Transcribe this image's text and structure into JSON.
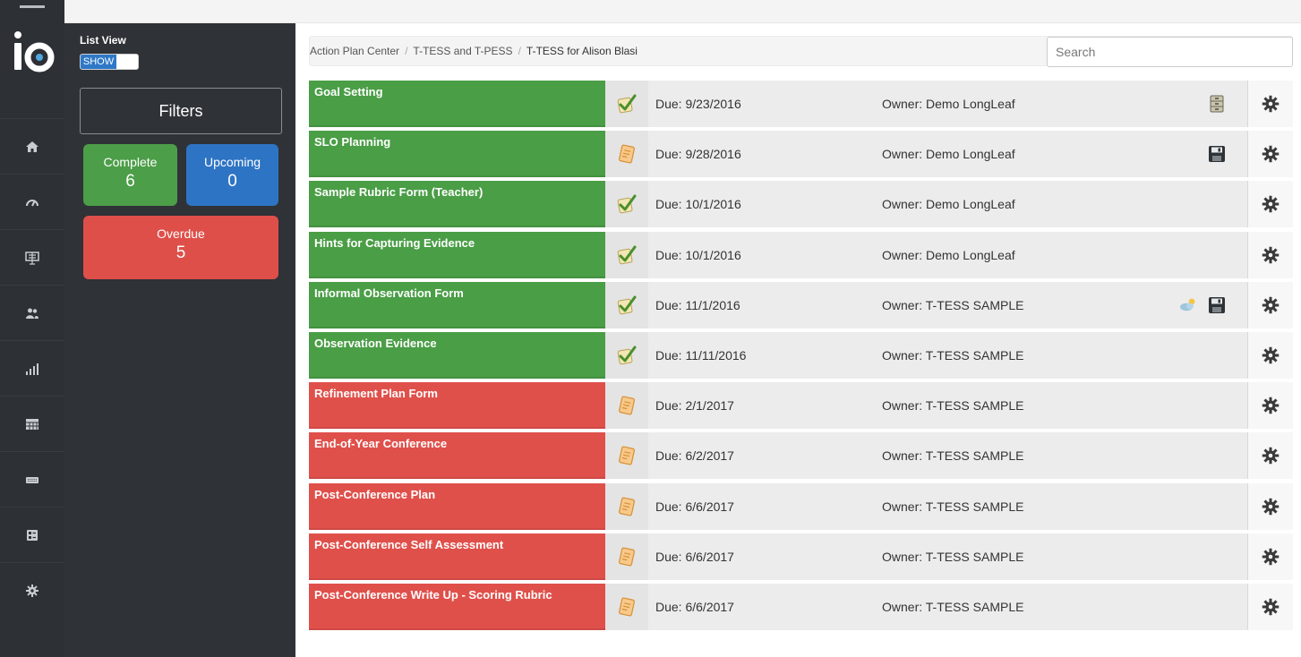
{
  "app": {
    "logo_text": "io",
    "list_view_label": "List View",
    "toggle_label": "SHOW"
  },
  "rail": {
    "items": [
      {
        "icon": "home-icon"
      },
      {
        "icon": "dashboard-gauge-icon"
      },
      {
        "icon": "presentation-board-icon"
      },
      {
        "icon": "users-icon"
      },
      {
        "icon": "bar-chart-icon"
      },
      {
        "icon": "calendar-grid-icon"
      },
      {
        "icon": "keyboard-icon"
      },
      {
        "icon": "forms-icon"
      },
      {
        "icon": "settings-icon"
      }
    ]
  },
  "filters": {
    "button_label": "Filters",
    "complete": {
      "label": "Complete",
      "count": "6",
      "color": "#4c9e48"
    },
    "upcoming": {
      "label": "Upcoming",
      "count": "0",
      "color": "#2e74c4"
    },
    "overdue": {
      "label": "Overdue",
      "count": "5",
      "color": "#de4f4a"
    }
  },
  "breadcrumb": {
    "items": [
      "Action Plan Center",
      "T-TESS and T-PESS",
      "T-TESS for Alison Blasi"
    ]
  },
  "search": {
    "placeholder": "Search",
    "value": ""
  },
  "rows": [
    {
      "title": "Goal Setting",
      "status": "complete",
      "status_icon": "checkmark-icon",
      "due": "Due: 9/23/2016",
      "owner": "Owner: Demo LongLeaf",
      "icons": [
        "archive-icon"
      ]
    },
    {
      "title": "SLO Planning",
      "status": "complete",
      "status_icon": "document-icon",
      "due": "Due: 9/28/2016",
      "owner": "Owner: Demo LongLeaf",
      "icons": [
        "save-disk-icon"
      ]
    },
    {
      "title": "Sample Rubric Form (Teacher)",
      "status": "complete",
      "status_icon": "checkmark-icon",
      "due": "Due: 10/1/2016",
      "owner": "Owner: Demo LongLeaf",
      "icons": []
    },
    {
      "title": "Hints for Capturing Evidence",
      "status": "complete",
      "status_icon": "checkmark-icon",
      "due": "Due: 10/1/2016",
      "owner": "Owner: Demo LongLeaf",
      "icons": []
    },
    {
      "title": "Informal Observation Form",
      "status": "complete",
      "status_icon": "checkmark-icon",
      "due": "Due: 11/1/2016",
      "owner": "Owner: T-TESS SAMPLE",
      "icons": [
        "weather-cloud-icon",
        "save-disk-icon"
      ]
    },
    {
      "title": "Observation Evidence",
      "status": "complete",
      "status_icon": "checkmark-icon",
      "due": "Due: 11/11/2016",
      "owner": "Owner: T-TESS SAMPLE",
      "icons": []
    },
    {
      "title": "Refinement Plan Form",
      "status": "overdue",
      "status_icon": "document-icon",
      "due": "Due: 2/1/2017",
      "owner": "Owner: T-TESS SAMPLE",
      "icons": []
    },
    {
      "title": "End-of-Year Conference",
      "status": "overdue",
      "status_icon": "document-icon",
      "due": "Due: 6/2/2017",
      "owner": "Owner: T-TESS SAMPLE",
      "icons": []
    },
    {
      "title": "Post-Conference Plan",
      "status": "overdue",
      "status_icon": "document-icon",
      "due": "Due: 6/6/2017",
      "owner": "Owner: T-TESS SAMPLE",
      "icons": []
    },
    {
      "title": "Post-Conference Self Assessment",
      "status": "overdue",
      "status_icon": "document-icon",
      "due": "Due: 6/6/2017",
      "owner": "Owner: T-TESS SAMPLE",
      "icons": []
    },
    {
      "title": "Post-Conference Write Up - Scoring Rubric",
      "status": "overdue",
      "status_icon": "document-icon",
      "due": "Due: 6/6/2017",
      "owner": "Owner: T-TESS SAMPLE",
      "icons": []
    }
  ],
  "colors": {
    "complete": "#4a9e46",
    "overdue": "#e0504b",
    "upcoming": "#2e74c4",
    "rail_bg": "#2d3035",
    "panel_bg": "#2f3237"
  }
}
